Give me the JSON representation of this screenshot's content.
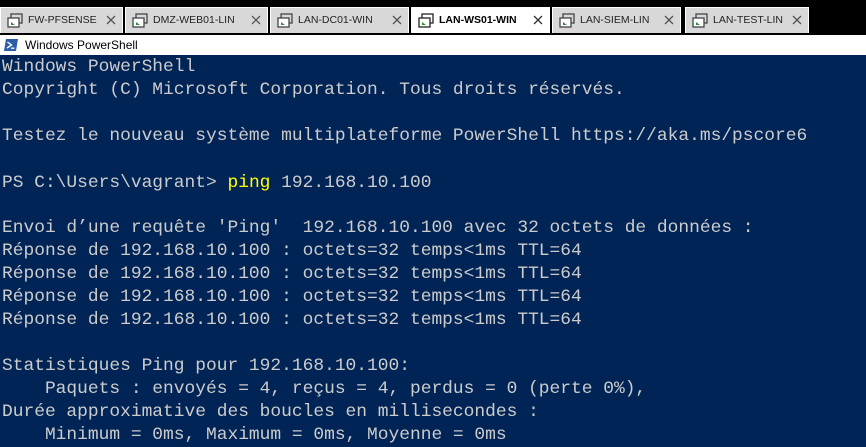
{
  "tabs": [
    {
      "label": "FW-PFSENSE",
      "active": false
    },
    {
      "label": "DMZ-WEB01-LIN",
      "active": false
    },
    {
      "label": "LAN-DC01-WIN",
      "active": false
    },
    {
      "label": "LAN-WS01-WIN",
      "active": true
    },
    {
      "label": "LAN-SIEM-LIN",
      "active": false
    },
    {
      "label": "LAN-TEST-LIN",
      "active": false
    }
  ],
  "window": {
    "title": "Windows PowerShell",
    "icon": "powershell-icon"
  },
  "console": {
    "header_line1": "Windows PowerShell",
    "header_line2": "Copyright (C) Microsoft Corporation. Tous droits réservés.",
    "promo_line": "Testez le nouveau système multiplateforme PowerShell https://aka.ms/pscore6",
    "prompt": "PS C:\\Users\\vagrant> ",
    "command": "ping",
    "command_args": " 192.168.10.100",
    "ping_header": "Envoi d’une requête 'Ping'  192.168.10.100 avec 32 octets de données :",
    "replies": [
      "Réponse de 192.168.10.100 : octets=32 temps<1ms TTL=64",
      "Réponse de 192.168.10.100 : octets=32 temps<1ms TTL=64",
      "Réponse de 192.168.10.100 : octets=32 temps<1ms TTL=64",
      "Réponse de 192.168.10.100 : octets=32 temps<1ms TTL=64"
    ],
    "stats_title": "Statistiques Ping pour 192.168.10.100:",
    "stats_packets": "    Paquets : envoyés = 4, reçus = 4, perdus = 0 (perte 0%),",
    "rtt_title": "Durée approximative des boucles en millisecondes :",
    "rtt_values": "    Minimum = 0ms, Maximum = 0ms, Moyenne = 0ms"
  },
  "colors": {
    "console_bg": "#012456",
    "console_fg": "#cccccc",
    "command_highlight": "#ffff00"
  }
}
